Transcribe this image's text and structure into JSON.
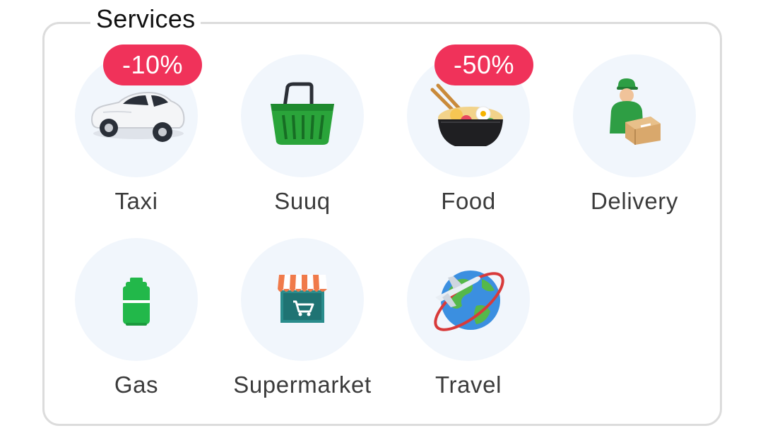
{
  "section": {
    "title": "Services"
  },
  "services": [
    {
      "label": "Taxi",
      "icon": "taxi-car-icon",
      "badge": "-10%"
    },
    {
      "label": "Suuq",
      "icon": "shopping-basket-icon"
    },
    {
      "label": "Food",
      "icon": "noodle-bowl-icon",
      "badge": "-50%"
    },
    {
      "label": "Delivery",
      "icon": "delivery-man-icon"
    },
    {
      "label": "Gas",
      "icon": "gas-cylinder-icon"
    },
    {
      "label": "Supermarket",
      "icon": "storefront-cart-icon"
    },
    {
      "label": "Travel",
      "icon": "globe-airplane-icon"
    }
  ],
  "colors": {
    "badge": "#f0325a",
    "icon_bg": "#f1f6fc",
    "border": "#dcdcdc",
    "gas_green": "#22b84a",
    "basket_green": "#2aa43a"
  }
}
